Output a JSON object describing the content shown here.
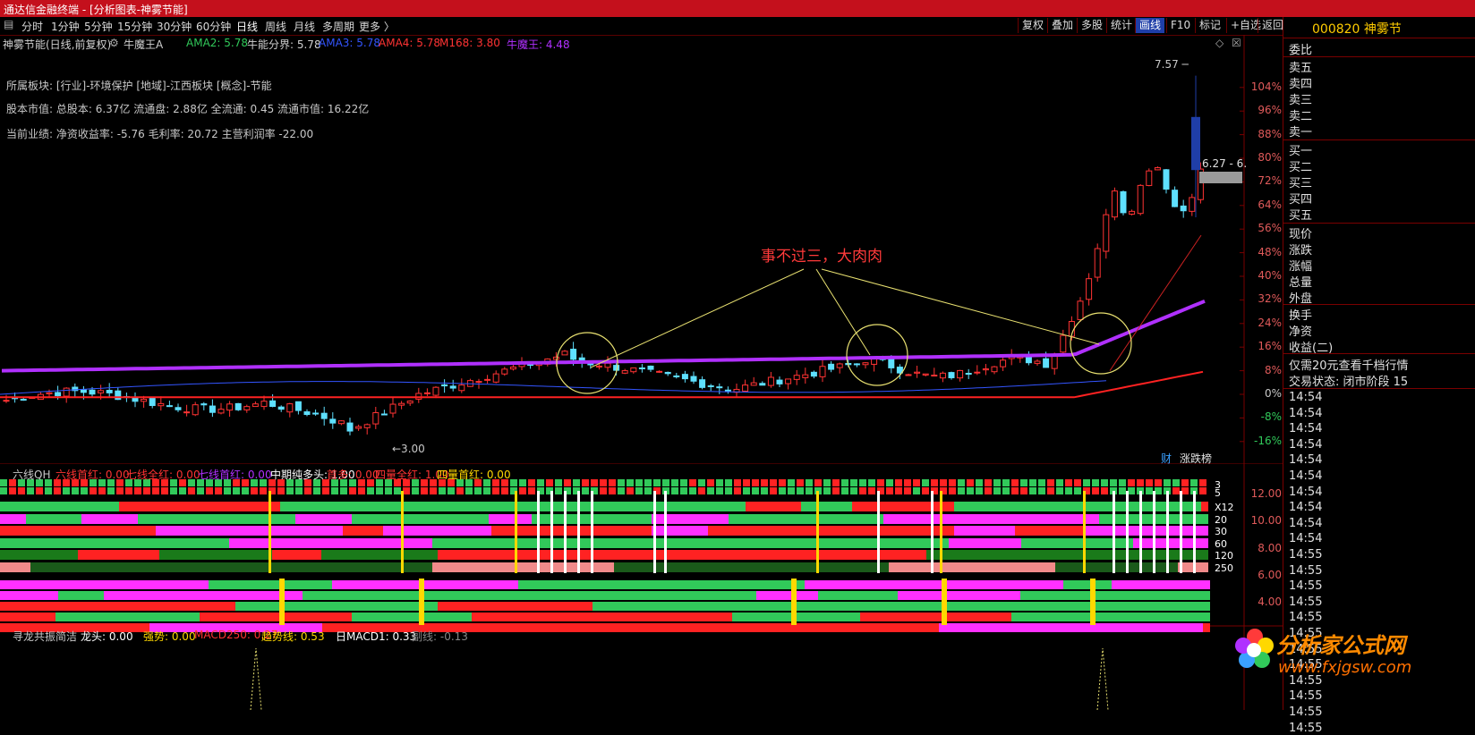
{
  "app": {
    "title": "通达信金融终端 - [分析图表-神雾节能]"
  },
  "periods": [
    "分时",
    "1分钟",
    "5分钟",
    "15分钟",
    "30分钟",
    "60分钟",
    "日线",
    "周线",
    "月线",
    "多周期",
    "更多 〉"
  ],
  "active_period": "日线",
  "right_toolbar": [
    "复权",
    "叠加",
    "多股",
    "统计",
    "画线",
    "F10",
    "标记",
    "+自选",
    "返回"
  ],
  "selected_tool": "画线",
  "stock_header": "神雾节能(日线,前复权)",
  "indicator_name": "牛魔王A",
  "legend": [
    {
      "text": "AMA2: 5.78",
      "color": "#31c95a"
    },
    {
      "text": "牛能分界: 5.78",
      "color": "#d0d0d0"
    },
    {
      "text": "AMA3: 5.78",
      "color": "#3355ff"
    },
    {
      "text": "AMA4: 5.78",
      "color": "#ff3333"
    },
    {
      "text": "M168: 3.80",
      "color": "#ff3333"
    },
    {
      "text": "牛魔王: 4.48",
      "color": "#b030ff"
    }
  ],
  "info_lines": [
    {
      "text": "所属板块: [行业]-环境保护 [地域]-江西板块 [概念]-节能",
      "color": "#ffd800"
    },
    {
      "text": "股本市值: 总股本: 6.37亿 流通盘: 2.88亿 全流通: 0.45 流通市值: 16.22亿",
      "color": "#31c95a"
    },
    {
      "text": "当前业绩: 净资收益率: -5.76 毛利率: 20.72 主营利润率 -22.00",
      "color": "#31c95a"
    }
  ],
  "annotation": "事不过三，大肉肉",
  "price_marks": {
    "high": "7.57",
    "low": "3.00",
    "current": "6.27 - 6."
  },
  "bottom_tags": [
    "财",
    "涨跌榜"
  ],
  "sub1": {
    "name": "六线QH",
    "legend": [
      {
        "text": "六线首红: 0.00",
        "color": "#ff3333"
      },
      {
        "text": "七线全红: 0.00",
        "color": "#ff3333"
      },
      {
        "text": "七线首红: 0.00",
        "color": "#b030ff"
      },
      {
        "text": "中期纯多头: 1.00",
        "color": "#ffffff"
      },
      {
        "text": "首多: 0.00",
        "color": "#ff3333"
      },
      {
        "text": "四量全红: 1.00",
        "color": "#ff3333"
      },
      {
        "text": "四量首红: 0.00",
        "color": "#ffd800"
      }
    ],
    "row_labels": [
      "3",
      "5",
      "X12",
      "20",
      "30",
      "60",
      "120",
      "250"
    ],
    "axis": [
      "12.00",
      "10.00",
      "8.00",
      "6.00",
      "4.00"
    ]
  },
  "sub2": {
    "name": "寻龙共振简洁",
    "legend": [
      {
        "text": "龙头: 0.00",
        "color": "#ffffff"
      },
      {
        "text": "强势: 0.00",
        "color": "#ffd800"
      },
      {
        "text": "MACD250: 0.27",
        "color": "#ff3333"
      },
      {
        "text": "趋势线: 0.53",
        "color": "#ffd800"
      },
      {
        "text": "日MACD1: 0.33",
        "color": "#ffffff"
      },
      {
        "text": "副线: -0.13",
        "color": "#888888"
      }
    ]
  },
  "right_panel": {
    "code_name": "000820 神雾节",
    "weibi": "委比",
    "sells": [
      "卖五",
      "卖四",
      "卖三",
      "卖二",
      "卖一"
    ],
    "buys": [
      "买一",
      "买二",
      "买三",
      "买四",
      "买五"
    ],
    "quote_labels": [
      "现价",
      "涨跌",
      "涨幅",
      "总量",
      "外盘"
    ],
    "more_labels": [
      "换手",
      "净资",
      "收益(二)"
    ],
    "promo": "仅需20元查看千档行情",
    "status": "交易状态: 闭市阶段 15",
    "ticks": [
      "14:54",
      "14:54",
      "14:54",
      "14:54",
      "14:54",
      "14:54",
      "14:54",
      "14:54",
      "14:54",
      "14:54",
      "14:55",
      "14:55",
      "14:55",
      "14:55",
      "14:55",
      "14:55",
      "14:55",
      "14:55",
      "14:55",
      "14:55",
      "14:55",
      "14:55"
    ]
  },
  "logo": {
    "name": "分析家公式网",
    "url": "www.fxjgsw.com"
  },
  "chart_data": {
    "type": "candlestick",
    "title": "神雾节能(日线,前复权)",
    "y_axis_percent": [
      "104%",
      "96%",
      "88%",
      "80%",
      "72%",
      "64%",
      "56%",
      "48%",
      "40%",
      "32%",
      "24%",
      "16%",
      "8%",
      "0%",
      "-8%",
      "-16%"
    ],
    "price_range": [
      3.0,
      7.57
    ],
    "bars_approx": 140,
    "series": [
      {
        "name": "牛魔王",
        "value": 4.48,
        "color": "#b030ff"
      },
      {
        "name": "M168",
        "value": 3.8,
        "color": "#ff3333"
      },
      {
        "name": "AMA3",
        "value": 5.78,
        "color": "#3355ff"
      }
    ]
  },
  "colors": {
    "up": "#ff3333",
    "down": "#31c95a",
    "down_fill": "#5ee0ff",
    "purple": "#b030ff",
    "yellow": "#ffd800",
    "bg": "#000000",
    "frame": "#7a0000"
  }
}
